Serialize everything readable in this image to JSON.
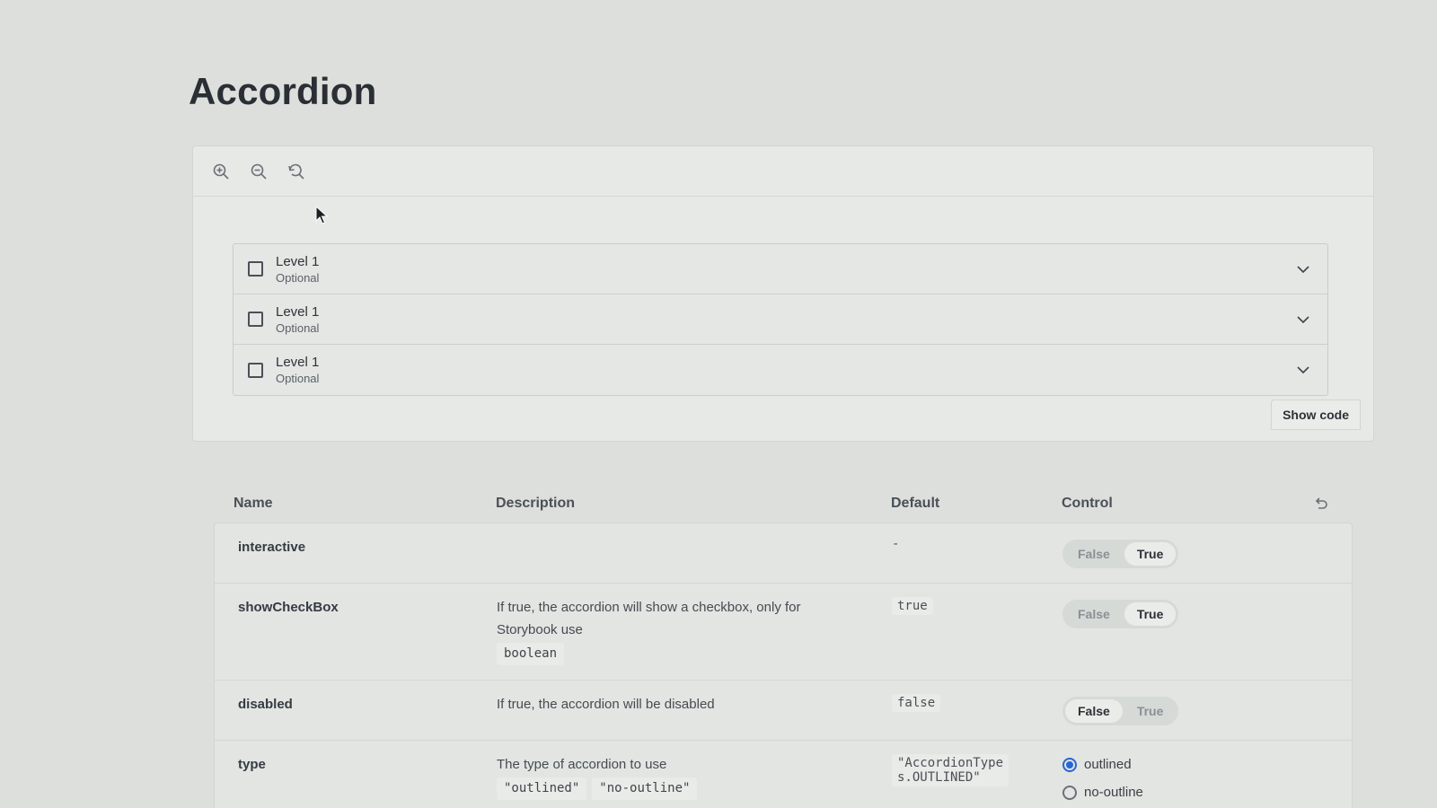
{
  "page": {
    "title": "Accordion"
  },
  "toolbar": {
    "buttons": [
      {
        "icon": "zoom-in-icon"
      },
      {
        "icon": "zoom-out-icon"
      },
      {
        "icon": "reset-zoom-icon"
      }
    ]
  },
  "accordion": {
    "items": [
      {
        "title": "Level 1",
        "subtitle": "Optional"
      },
      {
        "title": "Level 1",
        "subtitle": "Optional"
      },
      {
        "title": "Level 1",
        "subtitle": "Optional"
      }
    ]
  },
  "canvas": {
    "show_code_label": "Show code"
  },
  "props_table": {
    "headers": {
      "name": "Name",
      "description": "Description",
      "default": "Default",
      "control": "Control"
    },
    "rows": [
      {
        "name": "interactive",
        "description": "",
        "type_chips": [],
        "default": "-",
        "control": {
          "kind": "toggle",
          "false_label": "False",
          "true_label": "True",
          "selected": "True"
        }
      },
      {
        "name": "showCheckBox",
        "description": "If true, the accordion will show a checkbox, only for Storybook use",
        "type_chips": [
          "boolean"
        ],
        "default": "true",
        "control": {
          "kind": "toggle",
          "false_label": "False",
          "true_label": "True",
          "selected": "True"
        }
      },
      {
        "name": "disabled",
        "description": "If true, the accordion will be disabled",
        "type_chips": [],
        "default": "false",
        "control": {
          "kind": "toggle",
          "false_label": "False",
          "true_label": "True",
          "selected": "False"
        }
      },
      {
        "name": "type",
        "description": "The type of accordion to use",
        "type_chips": [
          "\"outlined\"",
          "\"no-outline\""
        ],
        "default": "\"AccordionTypes.OUTLINED\"",
        "control": {
          "kind": "radio",
          "options": [
            "outlined",
            "no-outline"
          ],
          "selected": "outlined"
        }
      }
    ]
  },
  "colors": {
    "accent": "#2866d4",
    "background": "#dcdfdc"
  }
}
